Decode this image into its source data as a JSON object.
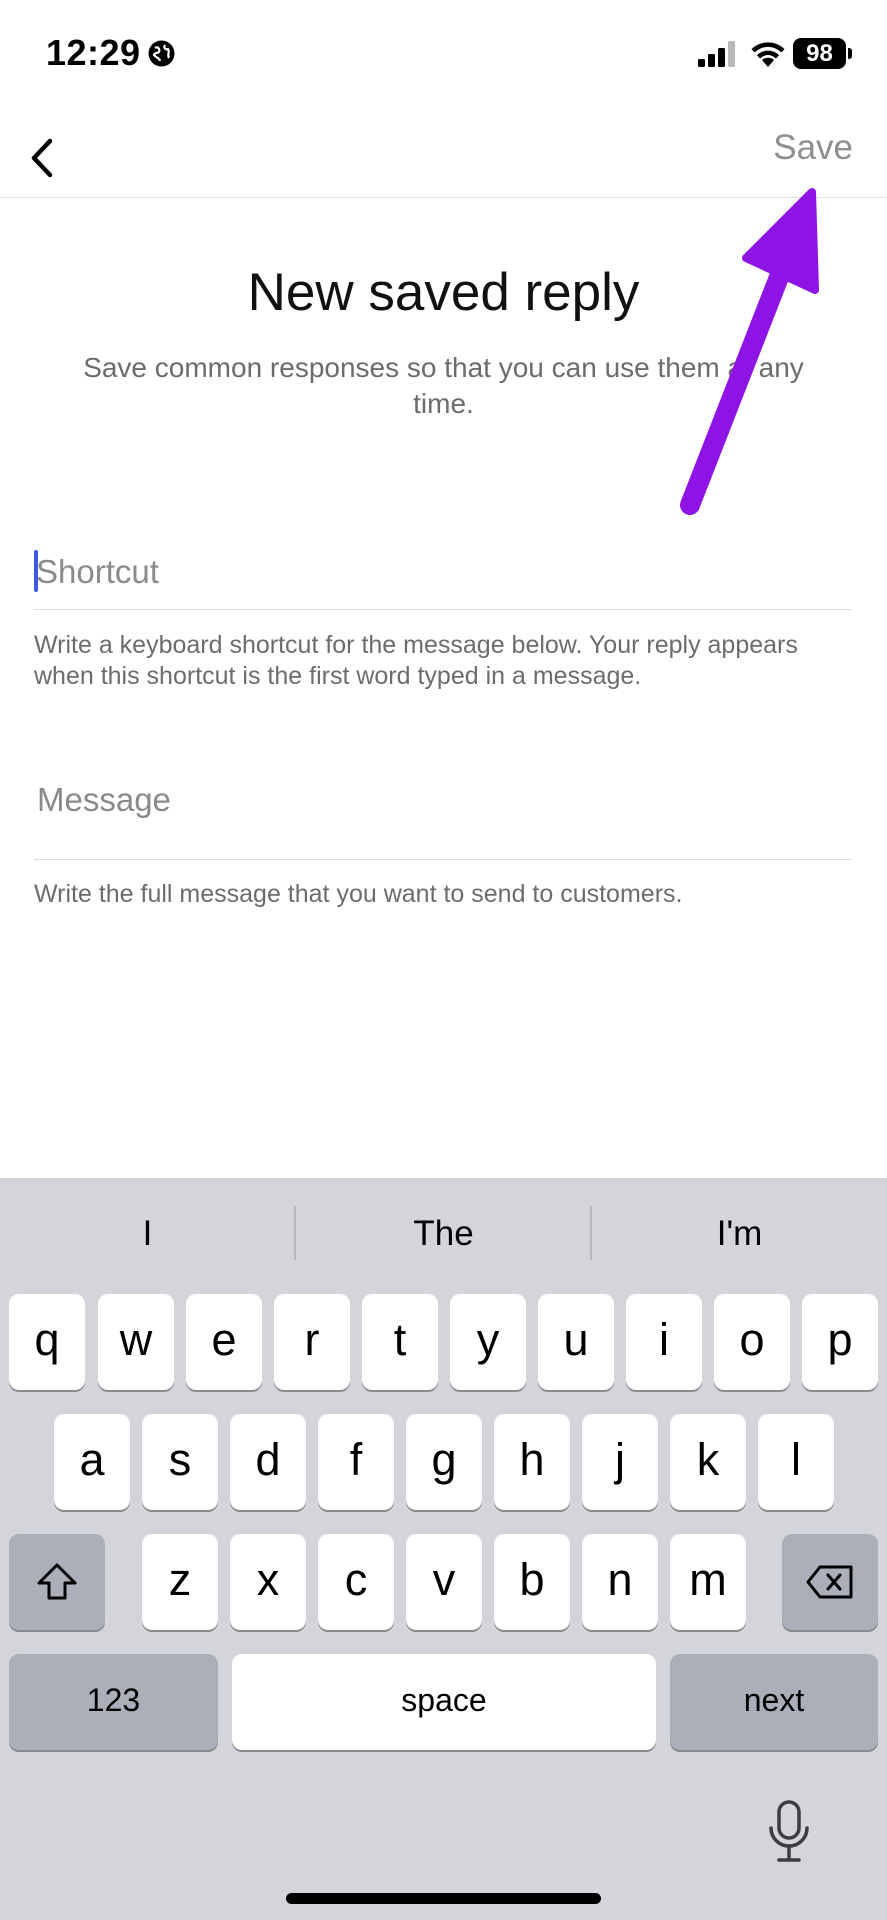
{
  "status_bar": {
    "time": "12:29",
    "battery": "98"
  },
  "nav": {
    "save_label": "Save"
  },
  "content": {
    "title": "New saved reply",
    "subtitle": "Save common responses so that you can use them at any time.",
    "shortcut_field": {
      "placeholder": "Shortcut",
      "value": "",
      "helper": "Write a keyboard shortcut for the message below. Your reply appears when this shortcut is the first word typed in a message."
    },
    "message_field": {
      "placeholder": "Message",
      "value": "",
      "helper": "Write the full message that you want to send to customers."
    }
  },
  "annotation": {
    "color": "#8e14e6"
  },
  "keyboard": {
    "suggestions": [
      "I",
      "The",
      "I'm"
    ],
    "row1": [
      "q",
      "w",
      "e",
      "r",
      "t",
      "y",
      "u",
      "i",
      "o",
      "p"
    ],
    "row2": [
      "a",
      "s",
      "d",
      "f",
      "g",
      "h",
      "j",
      "k",
      "l"
    ],
    "row3": [
      "z",
      "x",
      "c",
      "v",
      "b",
      "n",
      "m"
    ],
    "numbers_label": "123",
    "space_label": "space",
    "return_label": "next"
  }
}
